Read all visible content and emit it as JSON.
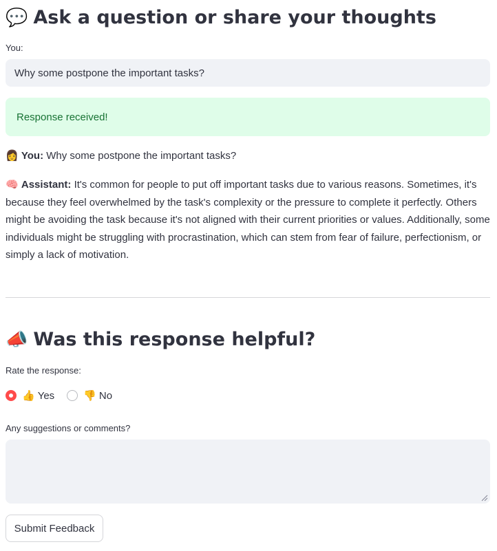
{
  "ask_section": {
    "icon": "speech-bubble-icon",
    "icon_glyph": "💬",
    "title": "Ask a question or share your thoughts",
    "input_label": "You:",
    "input_value": "Why some postpone the important tasks?"
  },
  "alert": {
    "text": "Response received!",
    "color": "#177233",
    "background": "#dffde9"
  },
  "chat": {
    "user_icon": "woman-icon",
    "user_glyph": "👩",
    "user_label": "You:",
    "user_text": "Why some postpone the important tasks?",
    "assistant_icon": "brain-icon",
    "assistant_glyph": "🧠",
    "assistant_label": "Assistant:",
    "assistant_text": "It's common for people to put off important tasks due to various reasons. Sometimes, it's because they feel overwhelmed by the task's complexity or the pressure to complete it perfectly. Others might be avoiding the task because it's not aligned with their current priorities or values. Additionally, some individuals might be struggling with procrastination, which can stem from fear of failure, perfectionism, or simply a lack of motivation."
  },
  "feedback": {
    "icon": "megaphone-icon",
    "icon_glyph": "📣",
    "title": "Was this response helpful?",
    "rating_label": "Rate the response:",
    "options": [
      {
        "glyph": "👍",
        "icon": "thumbs-up-icon",
        "label": "Yes",
        "selected": true
      },
      {
        "glyph": "👎",
        "icon": "thumbs-down-icon",
        "label": "No",
        "selected": false
      }
    ],
    "comments_label": "Any suggestions or comments?",
    "comments_value": "",
    "submit_label": "Submit Feedback",
    "accent_color": "#ff4b4b"
  }
}
